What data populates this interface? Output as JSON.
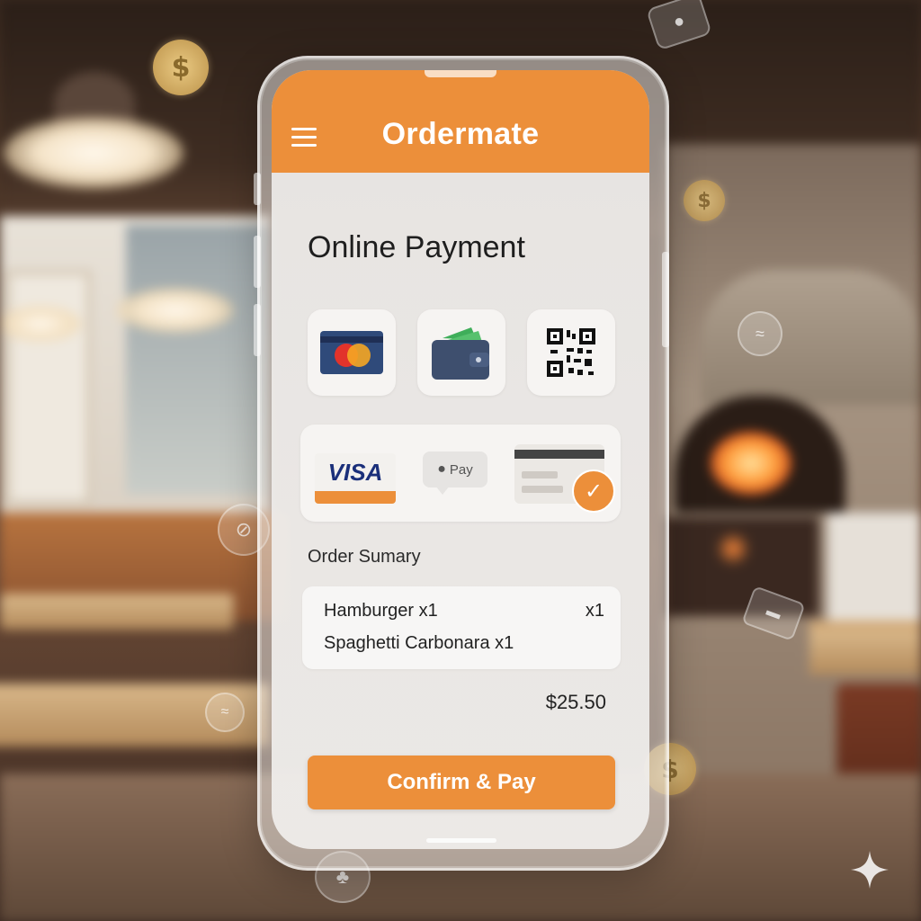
{
  "app": {
    "title": "Ordermate"
  },
  "page": {
    "heading": "Online Payment"
  },
  "payment_methods": [
    {
      "icon": "credit-card-icon"
    },
    {
      "icon": "wallet-icon"
    },
    {
      "icon": "qr-code-icon"
    }
  ],
  "providers": {
    "visa_label": "VISA",
    "applepay_label": "Pay"
  },
  "order_summary": {
    "label": "Order Sumary",
    "items": [
      {
        "name": "Hamburger x1",
        "qty": "x1"
      },
      {
        "name": "Spaghetti Carbonara x1",
        "qty": ""
      }
    ],
    "total": "$25.50"
  },
  "actions": {
    "confirm_label": "Confirm & Pay"
  },
  "floating_icons": {
    "coin_symbol": "$"
  },
  "colors": {
    "accent": "#ec8f3a",
    "heading": "#1e1e1e",
    "visa_blue": "#1a2f7a"
  }
}
